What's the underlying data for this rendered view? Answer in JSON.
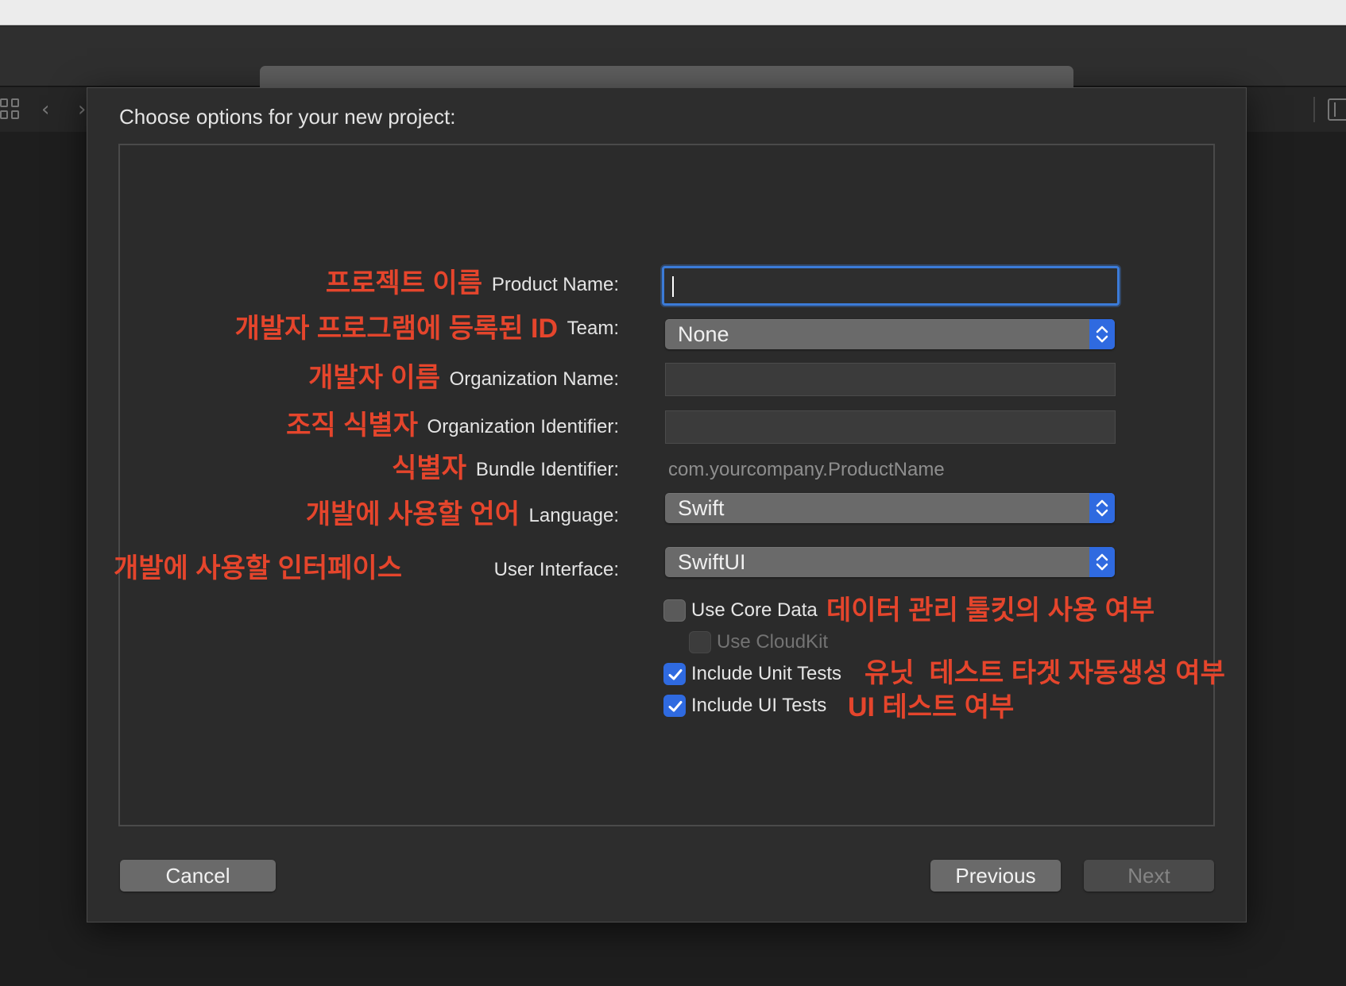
{
  "sheet": {
    "title": "Choose options for your new project:"
  },
  "form": {
    "product_name": {
      "annotation": "프로젝트 이름",
      "label": "Product Name:",
      "value": ""
    },
    "team": {
      "annotation": "개발자 프로그램에 등록된 ID",
      "label": "Team:",
      "value": "None"
    },
    "organization_name": {
      "annotation": "개발자 이름",
      "label": "Organization Name:",
      "value": ""
    },
    "organization_identifier": {
      "annotation": "조직 식별자",
      "label": "Organization Identifier:",
      "value": ""
    },
    "bundle_identifier": {
      "annotation": "식별자",
      "label": "Bundle Identifier:",
      "value": "com.yourcompany.ProductName"
    },
    "language": {
      "annotation": "개발에 사용할 언어",
      "label": "Language:",
      "value": "Swift"
    },
    "user_interface": {
      "annotation": "개발에 사용할 인터페이스",
      "label": "User Interface:",
      "value": "SwiftUI"
    }
  },
  "options": {
    "core_data": {
      "label": "Use Core Data",
      "annotation": "데이터 관리 툴킷의 사용 여부",
      "checked": false
    },
    "cloudkit": {
      "label": "Use CloudKit",
      "checked": false,
      "enabled": false
    },
    "unit_tests": {
      "label": "Include Unit Tests",
      "annotation": "유닛  테스트 타겟 자동생성 여부",
      "checked": true
    },
    "ui_tests": {
      "label": "Include UI Tests",
      "annotation": "UI 테스트 여부",
      "checked": true
    }
  },
  "buttons": {
    "cancel": "Cancel",
    "previous": "Previous",
    "next": "Next"
  },
  "colors": {
    "annotation": "#e5452c",
    "accent": "#2f6ae0",
    "focus_ring": "#3b7bd8"
  },
  "icons": {
    "toolbar": [
      "grid-icon",
      "chevron-left-icon",
      "chevron-right-icon",
      "add-editor-icon"
    ],
    "popup": "up-down-chevron-icon",
    "checkbox": "checkmark-icon"
  }
}
